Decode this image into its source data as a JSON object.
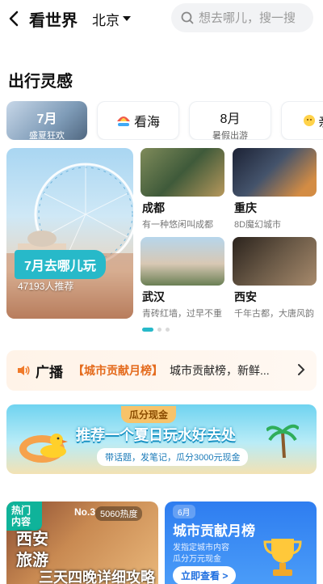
{
  "header": {
    "title": "看世界",
    "city": "北京",
    "search_placeholder": "想去哪儿，搜一搜"
  },
  "section": {
    "title": "出行灵感"
  },
  "tabs": [
    {
      "big": "7月",
      "small": "盛夏狂欢"
    },
    {
      "big": "看海"
    },
    {
      "big": "8月",
      "small": "暑假出游"
    },
    {
      "big": "亲"
    }
  ],
  "featured": {
    "badge": "7月去哪儿玩",
    "count": "47193人推荐"
  },
  "destinations": [
    {
      "name": "成都",
      "desc": "有一种悠闲叫成都"
    },
    {
      "name": "重庆",
      "desc": "8D魔幻城市"
    },
    {
      "name": "武汉",
      "desc": "青砖红墙，过早不重"
    },
    {
      "name": "西安",
      "desc": "千年古都，大唐风韵"
    }
  ],
  "broadcast": {
    "label": "广播",
    "highlight": "【城市贡献月榜】",
    "text": "城市贡献榜，新鲜..."
  },
  "banner": {
    "tag": "瓜分现金",
    "headline": "推荐一个夏日玩水好去处",
    "sub": "带话题，发笔记，瓜分3000元现金"
  },
  "card_left": {
    "hot": "热门内容",
    "rank": "No.3",
    "heat": "5060热度",
    "line1": "西安",
    "line2": "旅游",
    "line3": "三天四晚详细攻略"
  },
  "card_right": {
    "month": "6月",
    "title": "城市贡献月榜",
    "line1": "发指定城市内容",
    "line2": "瓜分万元现金",
    "button": "立即查看 >"
  },
  "colors": {
    "accent": "#27b9c9",
    "broadcast_highlight": "#e46a1c",
    "card_right_bg": "#2e7df0"
  }
}
